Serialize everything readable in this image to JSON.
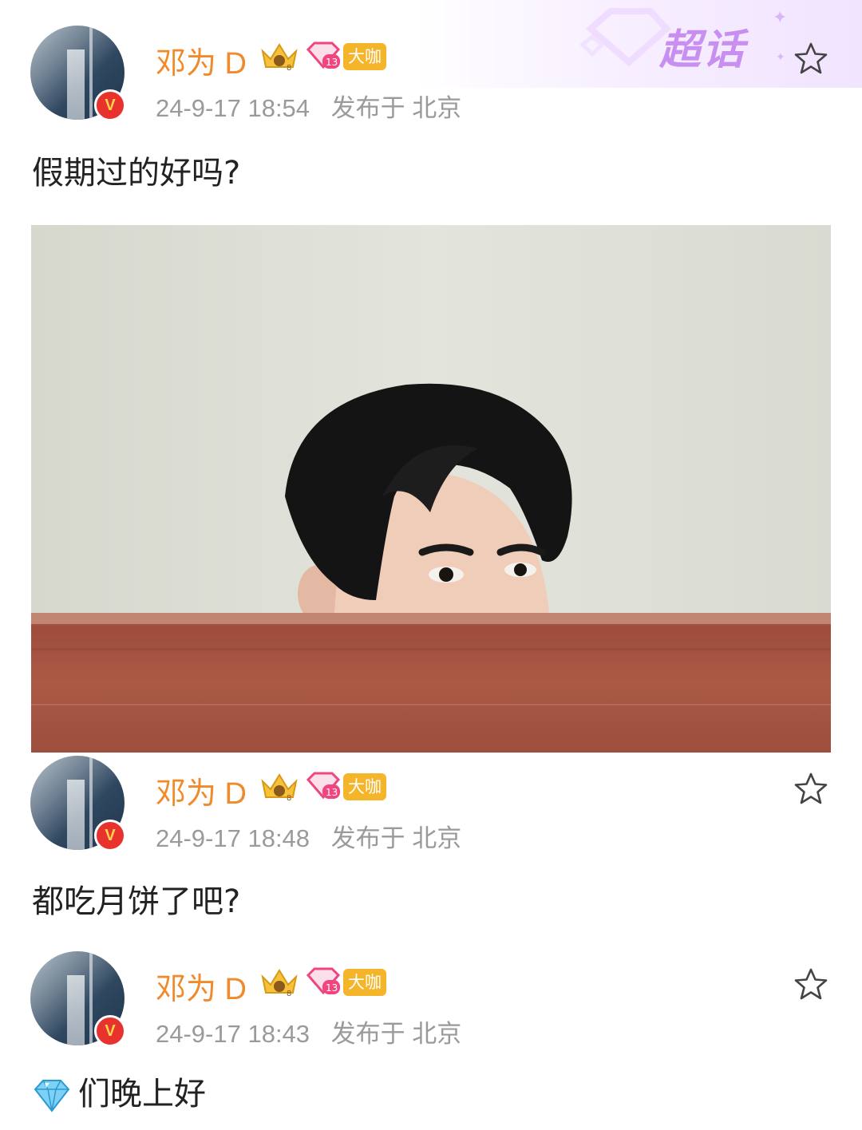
{
  "header": {
    "supertopic_label": "超话"
  },
  "posts": [
    {
      "author": "邓为 D",
      "crown_level": "8",
      "gem_level": "13",
      "badge": "大咖",
      "timestamp": "24-9-17 18:54",
      "location": "发布于 北京",
      "text": "假期过的好吗?"
    },
    {
      "author": "邓为 D",
      "crown_level": "8",
      "gem_level": "13",
      "badge": "大咖",
      "timestamp": "24-9-17 18:48",
      "location": "发布于 北京",
      "text": "都吃月饼了吧?"
    },
    {
      "author": "邓为 D",
      "crown_level": "8",
      "gem_level": "13",
      "badge": "大咖",
      "timestamp": "24-9-17 18:43",
      "location": "发布于 北京",
      "text": "们晚上好"
    }
  ],
  "icons": {
    "verified": "verified-v-icon",
    "favorite": "star-outline-icon",
    "crown": "crown-icon",
    "gem": "gem-icon",
    "diamond_emoji": "diamond-emoji-icon"
  },
  "colors": {
    "name": "#f08a2a",
    "meta": "#9a9a9a",
    "verified": "#e8322e",
    "badge": "#f5b52a",
    "supertopic": "#c98ff0"
  }
}
